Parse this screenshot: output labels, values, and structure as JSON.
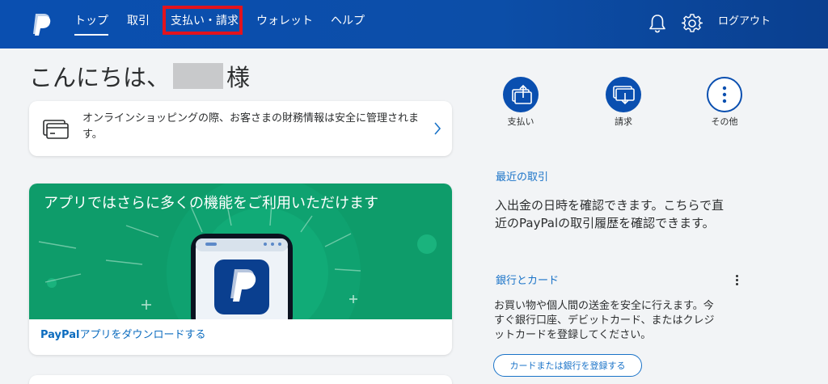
{
  "nav": {
    "items": [
      {
        "label": "トップ",
        "active": true
      },
      {
        "label": "取引"
      },
      {
        "label": "支払い・請求",
        "highlighted": true
      },
      {
        "label": "ウォレット"
      },
      {
        "label": "ヘルプ"
      }
    ],
    "logout_label": "ログアウト",
    "icons": [
      "paypal-logo",
      "bell-icon",
      "gear-icon"
    ]
  },
  "greeting": {
    "prefix": "こんにちは、",
    "suffix": "様"
  },
  "info_card": {
    "text": "オンラインショッピングの際、お客さまの財務情報は安全に管理されます。"
  },
  "promo": {
    "title": "アプリではさらに多くの機能をご利用いただけます",
    "link_brand": "PayPal",
    "link_text": "アプリをダウンロードする"
  },
  "quick_actions": [
    {
      "label": "支払い",
      "icon": "send-icon"
    },
    {
      "label": "請求",
      "icon": "request-icon"
    },
    {
      "label": "その他",
      "icon": "more-icon"
    }
  ],
  "recent": {
    "title": "最近の取引",
    "line1": "入出金の日時を確認できます。こちらで直",
    "line2": "近のPayPalの取引履歴を確認できます。"
  },
  "bank": {
    "title": "銀行とカード",
    "line1": "お買い物や個人間の送金を安全に行えます。今",
    "line2": "すぐ銀行口座、デビットカード、またはクレジ",
    "line3": "ットカードを登録してください。",
    "button_label": "カードまたは銀行を登録する"
  },
  "colors": {
    "header_blue": "#0a4fb0",
    "promo_green": "#0e9c6a",
    "link_blue": "#1a73c8",
    "highlight_red": "#e3131d"
  }
}
